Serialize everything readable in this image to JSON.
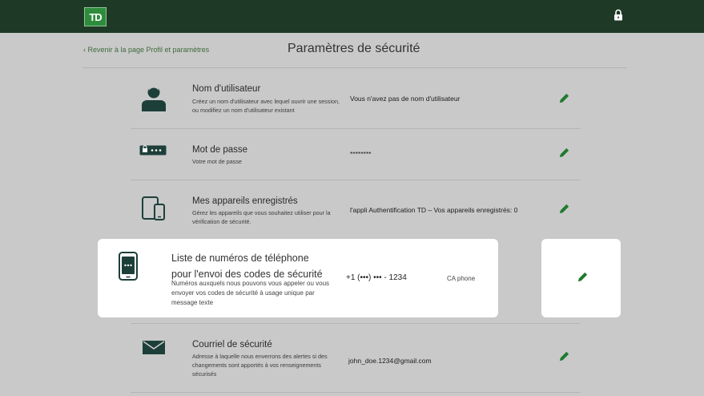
{
  "header": {
    "logo_text": "TD",
    "lock_icon": "lock-icon"
  },
  "nav": {
    "back_label": "‹ Revenir à la page Profil et paramètres"
  },
  "page": {
    "title": "Paramètres de sécurité"
  },
  "colors": {
    "topbar": "#1e3a26",
    "brand_green": "#2e8c3c",
    "edit_green": "#1f7a2e",
    "page_bg": "#c9c9c9"
  },
  "rows": {
    "username": {
      "icon": "user-icon",
      "title": "Nom d'utilisateur",
      "desc": "Créez un nom d'utilisateur avec lequel ouvrir une session, ou modifiez un nom d'utilisateur existant",
      "value": "Vous n'avez pas de nom d'utilisateur"
    },
    "password": {
      "icon": "password-icon",
      "title": "Mot de passe",
      "desc": "Votre mot de passe",
      "value": "********"
    },
    "devices": {
      "icon": "devices-icon",
      "title": "Mes appareils enregistrés",
      "desc": "Gérez les appareils que vous souhaitez utiliser pour la vérification de sécurité.",
      "value": "l'appli Authentification TD – Vos appareils enregistrés: 0"
    },
    "phones": {
      "icon": "phone-icon",
      "title": "Liste de numéros de téléphone pour l'envoi des codes de sécurité",
      "desc": "Numéros auxquels nous pouvons vous appeler ou vous envoyer vos codes de sécurité à usage unique par message texte",
      "value": "+1 (•••) ••• - 1234",
      "label": "CA phone"
    },
    "email": {
      "icon": "envelope-icon",
      "title": "Courriel de sécurité",
      "desc": "Adresse à laquelle nous enverrons des alertes si des changements sont apportés à vos renseignements sécurisés",
      "value": "john_doe.1234@gmail.com"
    }
  }
}
